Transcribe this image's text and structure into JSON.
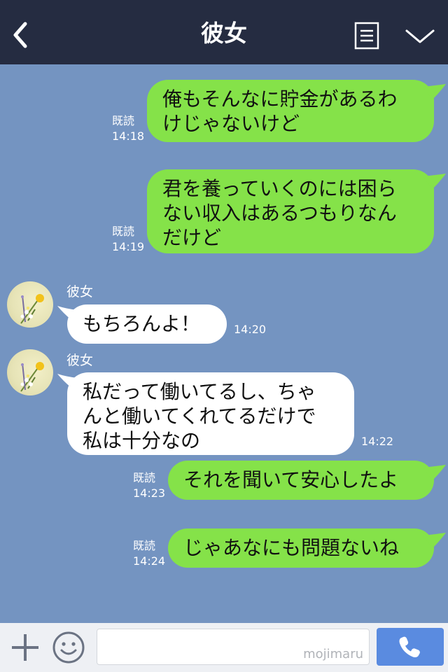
{
  "header": {
    "title": "彼女",
    "back_icon": "chevron-left-icon",
    "menu_icon": "document-list-icon",
    "collapse_icon": "chevron-down-icon"
  },
  "messages": [
    {
      "from": "me",
      "text": "俺もそんなに貯金があるわけじゃないけど",
      "lines": [
        "俺もそんなに貯金があるわ",
        "けじゃないけど"
      ],
      "read": "既読",
      "time": "14:18"
    },
    {
      "from": "me",
      "text": "君を養っていくのには困らない収入はあるつもりなんだけど",
      "lines": [
        "君を養っていくのには困ら",
        "ない収入はあるつもりなん",
        "だけど"
      ],
      "read": "既読",
      "time": "14:19"
    },
    {
      "from": "them",
      "sender": "彼女",
      "text": "もちろんよ！",
      "lines": [
        "もちろんよ！"
      ],
      "time": "14:20"
    },
    {
      "from": "them",
      "sender": "彼女",
      "text": "私だって働いてるし、ちゃんと働いてくれてるだけで私は十分なの",
      "lines": [
        "私だって働いてるし、ちゃ",
        "んと働いてくれてるだけで",
        "私は十分なの"
      ],
      "time": "14:22"
    },
    {
      "from": "me",
      "text": "それを聞いて安心したよ",
      "lines": [
        "それを聞いて安心したよ"
      ],
      "read": "既読",
      "time": "14:23"
    },
    {
      "from": "me",
      "text": "じゃあなにも問題ないね",
      "lines": [
        "じゃあなにも問題ないね"
      ],
      "read": "既読",
      "time": "14:24"
    }
  ],
  "composer": {
    "watermark": "mojimaru",
    "plus_icon": "plus-icon",
    "sticker_icon": "smile-icon",
    "call_icon": "phone-icon"
  },
  "colors": {
    "header_bg": "#252c41",
    "chat_bg": "#7494c1",
    "my_bubble": "#85e249",
    "their_bubble": "#ffffff",
    "call_button": "#5a8be0"
  }
}
